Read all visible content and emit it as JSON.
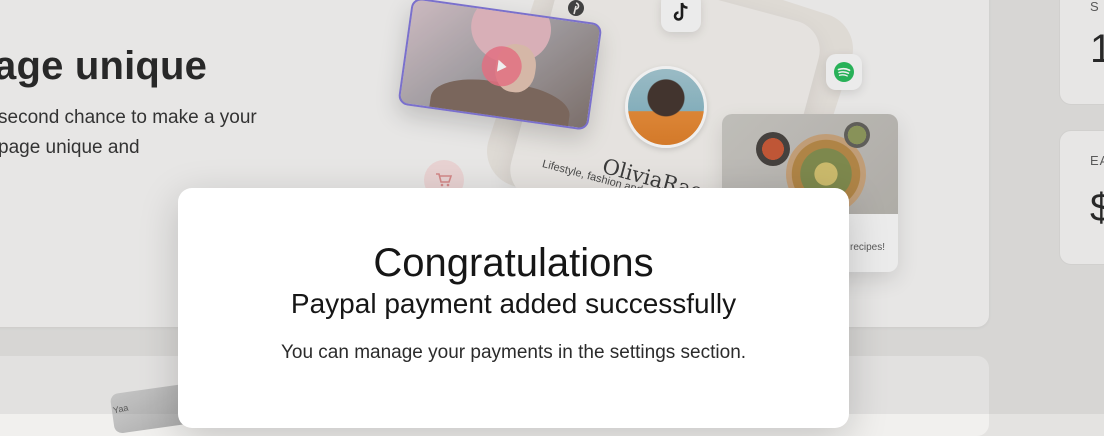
{
  "hero": {
    "title": "age unique",
    "text": "second chance to make a your page unique and"
  },
  "stats": [
    {
      "label": "S",
      "value": "1"
    },
    {
      "label": "EA",
      "value": "$"
    }
  ],
  "collage": {
    "profile_name": "OliviaRae",
    "profile_bio": "Lifestyle, fashion and",
    "food_caption": "recipes!",
    "thumb_text": "Yaa",
    "icons": [
      "tiktok-icon",
      "spotify-icon",
      "pinterest-icon",
      "cart-icon",
      "play-icon"
    ]
  },
  "modal": {
    "title": "Congratulations",
    "subtitle": "Paypal payment added successfully",
    "text": "You can manage your payments in the settings section."
  },
  "colors": {
    "modal_bg": "#ffffff",
    "page_bg": "#e4e3e1",
    "video_border": "#7a6fd8",
    "spotify": "#1db954"
  }
}
